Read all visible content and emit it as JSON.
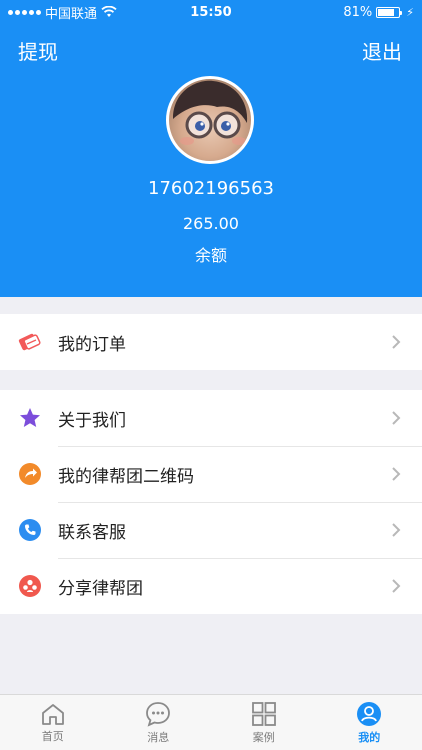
{
  "status_bar": {
    "carrier": "中国联通",
    "time": "15:50",
    "battery_percent": "81%",
    "battery_level": 0.81
  },
  "header": {
    "withdraw_label": "提现",
    "logout_label": "退出",
    "phone": "17602196563",
    "balance_value": "265.00",
    "balance_label": "余额",
    "background_color": "#1a8ff5"
  },
  "menu": {
    "orders": {
      "label": "我的订单",
      "icon": "order-icon"
    },
    "about": {
      "label": "关于我们",
      "icon": "star-icon"
    },
    "qrcode": {
      "label": "我的律帮团二维码",
      "icon": "share-arrow-icon"
    },
    "contact": {
      "label": "联系客服",
      "icon": "phone-icon"
    },
    "share": {
      "label": "分享律帮团",
      "icon": "share-people-icon"
    }
  },
  "tabbar": {
    "home": {
      "label": "首页",
      "icon": "home-icon"
    },
    "messages": {
      "label": "消息",
      "icon": "chat-icon"
    },
    "cases": {
      "label": "案例",
      "icon": "grid-icon"
    },
    "mine": {
      "label": "我的",
      "icon": "user-icon",
      "active": true
    },
    "active_color": "#1a8ff5"
  }
}
